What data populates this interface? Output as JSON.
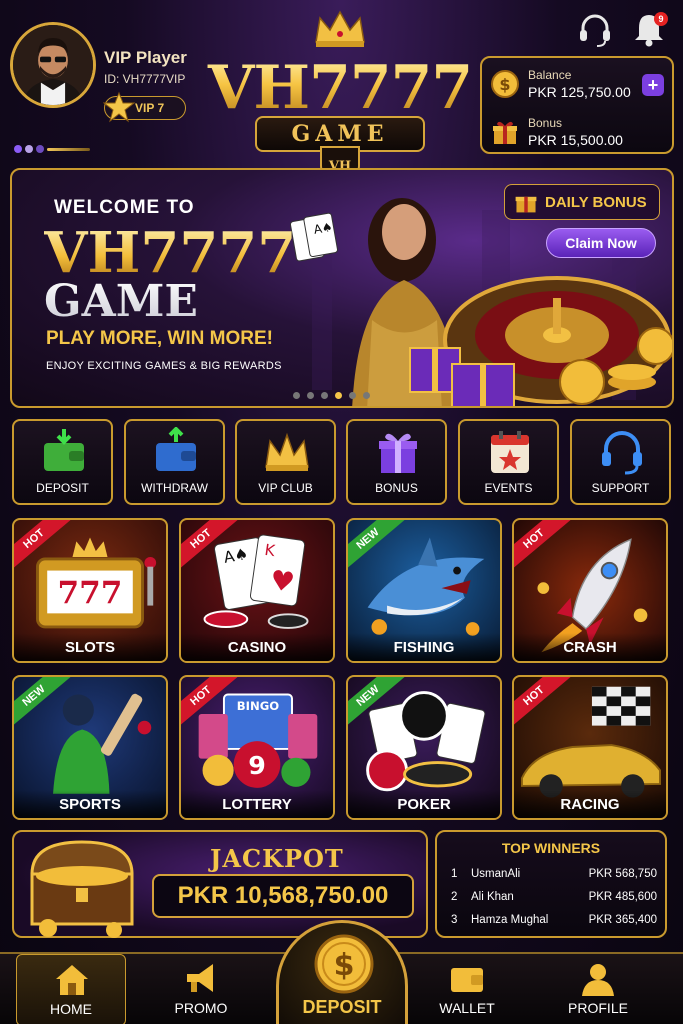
{
  "header": {
    "player_name": "VIP Player",
    "player_id": "ID: VH7777VIP",
    "vip_level": "VIP 7",
    "logo_text": "VH7777",
    "logo_sub": "GAME",
    "logo_shield": "VH",
    "notification_count": "9"
  },
  "balance": {
    "balance_label": "Balance",
    "balance_value": "PKR 125,750.00",
    "bonus_label": "Bonus",
    "bonus_value": "PKR 15,500.00",
    "add_label": "+"
  },
  "banner": {
    "welcome": "WELCOME TO",
    "title": "VH7777",
    "subtitle": "GAME",
    "tagline": "PLAY MORE, WIN MORE!",
    "small": "ENJOY EXCITING GAMES & BIG REWARDS",
    "daily_bonus": "DAILY BONUS",
    "claim": "Claim Now",
    "active_slide": 4
  },
  "quick_actions": [
    {
      "label": "DEPOSIT",
      "icon": "wallet-deposit-icon"
    },
    {
      "label": "WITHDRAW",
      "icon": "wallet-withdraw-icon"
    },
    {
      "label": "VIP CLUB",
      "icon": "crown-icon"
    },
    {
      "label": "BONUS",
      "icon": "gift-icon"
    },
    {
      "label": "EVENTS",
      "icon": "calendar-icon"
    },
    {
      "label": "SUPPORT",
      "icon": "headset-icon"
    }
  ],
  "games": [
    {
      "label": "SLOTS",
      "tag": "HOT"
    },
    {
      "label": "CASINO",
      "tag": "HOT"
    },
    {
      "label": "FISHING",
      "tag": "NEW"
    },
    {
      "label": "CRASH",
      "tag": "HOT"
    },
    {
      "label": "SPORTS",
      "tag": "NEW"
    },
    {
      "label": "LOTTERY",
      "tag": "HOT"
    },
    {
      "label": "POKER",
      "tag": "NEW"
    },
    {
      "label": "RACING",
      "tag": "HOT"
    }
  ],
  "jackpot": {
    "title": "JACKPOT",
    "amount": "PKR 10,568,750.00"
  },
  "winners": {
    "title": "TOP WINNERS",
    "rows": [
      {
        "rank": "1",
        "name": "UsmanAli",
        "amount": "PKR 568,750"
      },
      {
        "rank": "2",
        "name": "Ali Khan",
        "amount": "PKR 485,600"
      },
      {
        "rank": "3",
        "name": "Hamza Mughal",
        "amount": "PKR 365,400"
      }
    ]
  },
  "nav": {
    "home": "HOME",
    "promo": "PROMO",
    "deposit": "DEPOSIT",
    "wallet": "WALLET",
    "profile": "PROFILE"
  },
  "colors": {
    "gold": "#c99a2e",
    "accent_purple": "#7b3fe0",
    "hot": "#d3162a",
    "new": "#2fa334"
  }
}
